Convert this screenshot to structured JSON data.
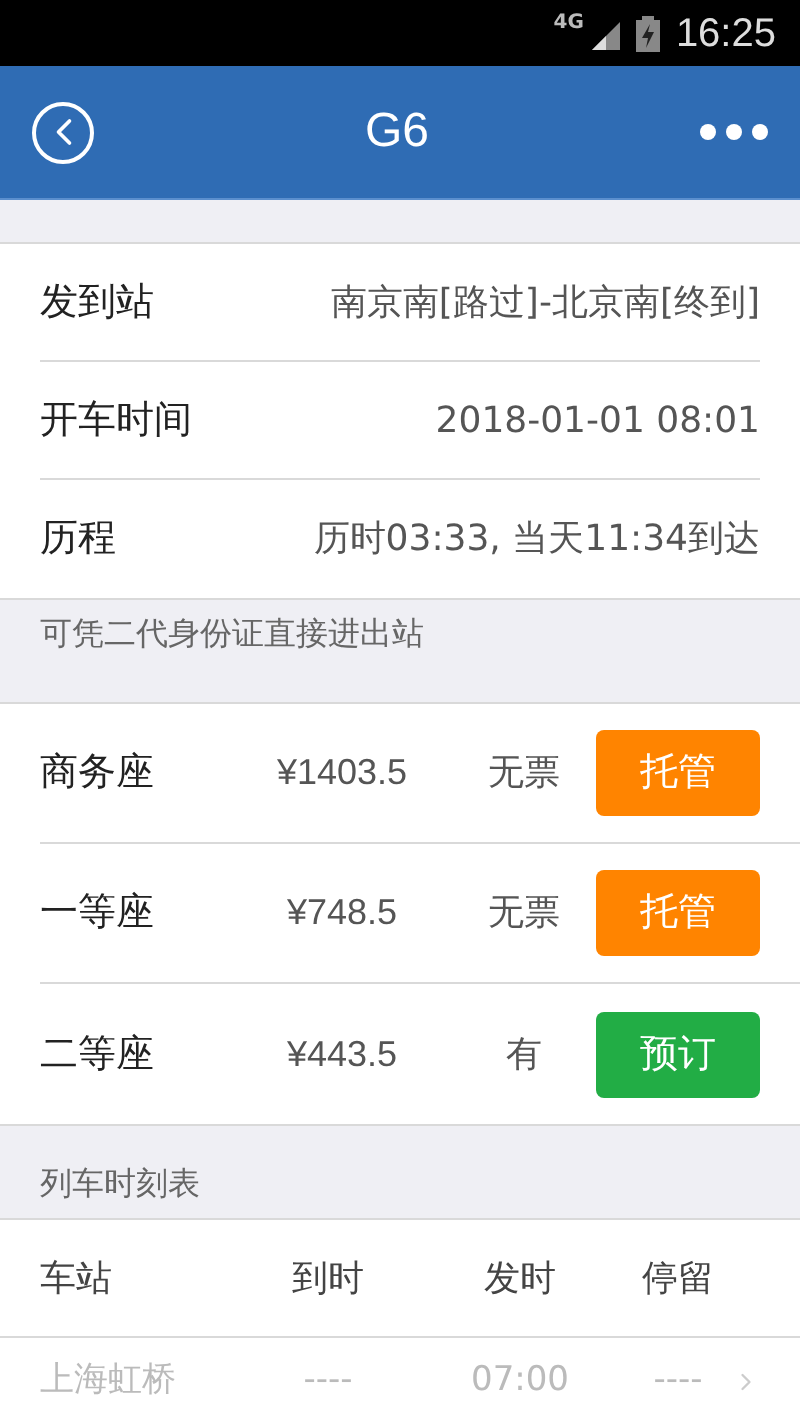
{
  "status_bar": {
    "network": "4G",
    "time": "16:25"
  },
  "header": {
    "title": "G6"
  },
  "info": [
    {
      "label": "发到站",
      "value": "南京南[路过]-北京南[终到]"
    },
    {
      "label": "开车时间",
      "value": "2018-01-01 08:01"
    },
    {
      "label": "历程",
      "value": "历时03:33, 当天11:34到达"
    }
  ],
  "note": "可凭二代身份证直接进出站",
  "seats": [
    {
      "name": "商务座",
      "price": "¥1403.5",
      "availability": "无票",
      "action": {
        "label": "托管",
        "kind": "hosting"
      }
    },
    {
      "name": "一等座",
      "price": "¥748.5",
      "availability": "无票",
      "action": {
        "label": "托管",
        "kind": "hosting"
      }
    },
    {
      "name": "二等座",
      "price": "¥443.5",
      "availability": "有",
      "action": {
        "label": "预订",
        "kind": "book"
      }
    }
  ],
  "timetable": {
    "title": "列车时刻表",
    "columns": [
      "车站",
      "到时",
      "发时",
      "停留"
    ],
    "rows": [
      {
        "cells": [
          "上海虹桥",
          "----",
          "07:00",
          "----"
        ]
      }
    ]
  }
}
